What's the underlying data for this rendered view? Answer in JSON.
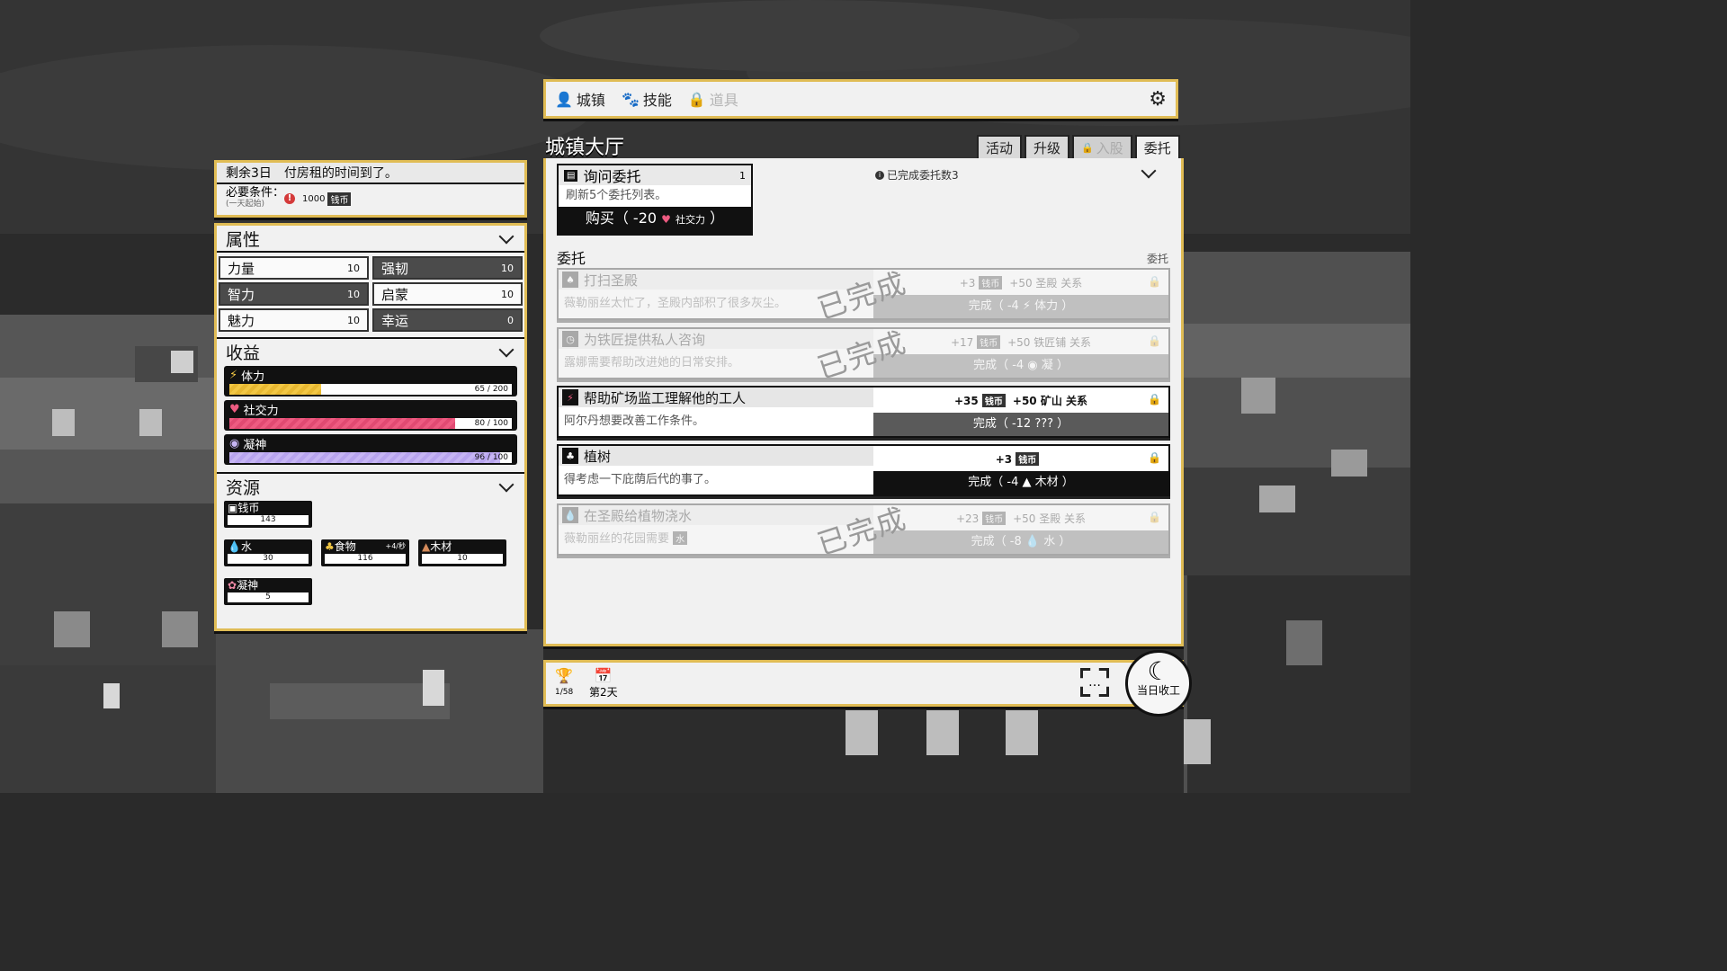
{
  "notice": {
    "days_left": "剩余3日",
    "message": "付房租的时间到了。",
    "req_label": "必要条件：",
    "req_sub": "(一天起始)",
    "req_amount": "1000",
    "req_currency": "钱币"
  },
  "attributes": {
    "title": "属性",
    "items": [
      {
        "name": "力量",
        "value": "10"
      },
      {
        "name": "强韧",
        "value": "10"
      },
      {
        "name": "智力",
        "value": "10"
      },
      {
        "name": "启蒙",
        "value": "10"
      },
      {
        "name": "魅力",
        "value": "10"
      },
      {
        "name": "幸运",
        "value": "0"
      }
    ]
  },
  "income": {
    "title": "收益",
    "bars": [
      {
        "name": "体力",
        "value": "65 / 200",
        "current": 65,
        "max": 200,
        "icon": "lightning-icon"
      },
      {
        "name": "社交力",
        "value": "80 / 100",
        "current": 80,
        "max": 100,
        "icon": "heart-icon"
      },
      {
        "name": "凝神",
        "value": "96 / 100",
        "current": 96,
        "max": 100,
        "icon": "focus-icon"
      }
    ]
  },
  "resources": {
    "title": "资源",
    "items": [
      {
        "name": "钱币",
        "value": "143",
        "rate": ""
      },
      {
        "name": "水",
        "value": "30",
        "rate": ""
      },
      {
        "name": "食物",
        "value": "116",
        "rate": "+4/秒"
      },
      {
        "name": "木材",
        "value": "10",
        "rate": ""
      },
      {
        "name": "凝神",
        "value": "5",
        "rate": ""
      }
    ]
  },
  "nav": {
    "tabs": [
      {
        "label": "城镇",
        "icon": "person-icon"
      },
      {
        "label": "技能",
        "icon": "paw-icon"
      },
      {
        "label": "道具",
        "icon": "lock-icon"
      }
    ]
  },
  "hall": {
    "title": "城镇大厅",
    "subtabs": [
      "活动",
      "升级",
      "入股",
      "委托"
    ]
  },
  "inquiry": {
    "title": "询问委托",
    "count": "1",
    "desc": "刷新5个委托列表。",
    "buy_label": "购买（ -20",
    "buy_cost_name": "社交力",
    "buy_close": "）"
  },
  "completed_count": "已完成委托数3",
  "commission_title": "委托",
  "commission_title_right": "委托",
  "stamp_text": "已完成",
  "tasks": [
    {
      "title": "打扫圣殿",
      "desc": "薇勒丽丝太忙了，圣殿内部积了很多灰尘。",
      "reward": "+3",
      "reward2": "钱币",
      "rel": "+50 圣殿 关系",
      "button": "完成（ -4 ⚡ 体力 ）",
      "done": true
    },
    {
      "title": "为铁匠提供私人咨询",
      "desc": "露娜需要帮助改进她的日常安排。",
      "reward": "+17",
      "reward2": "钱币",
      "rel": "+50 铁匠铺 关系",
      "button": "完成（ -4 ◉ 凝 ）",
      "done": true
    },
    {
      "title": "帮助矿场监工理解他的工人",
      "desc": "阿尔丹想要改善工作条件。",
      "reward": "+35",
      "reward2": "钱币",
      "rel": "+50 矿山 关系",
      "button": "完成（ -12 ??? ）",
      "done": false
    },
    {
      "title": "植树",
      "desc": "得考虑一下庇荫后代的事了。",
      "reward": "+3",
      "reward2": "钱币",
      "rel": "",
      "button": "完成（ -4 ▲ 木材 ）",
      "done": false
    },
    {
      "title": "在圣殿给植物浇水",
      "desc": "薇勒丽丝的花园需要",
      "desc_tag": "水",
      "reward": "+23",
      "reward2": "钱币",
      "rel": "+50 圣殿 关系",
      "button": "完成（ -8 💧 水 ）",
      "done": true
    }
  ],
  "bottom": {
    "trophy_count": "1/58",
    "day": "第2天",
    "end_day": "当日收工"
  }
}
